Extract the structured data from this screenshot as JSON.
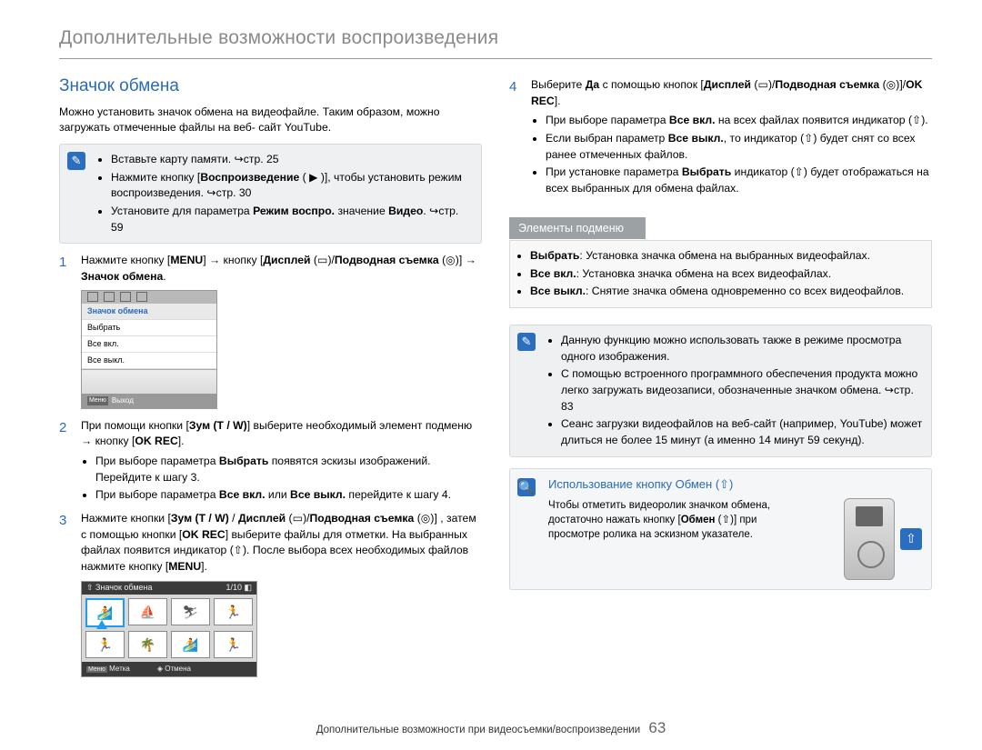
{
  "chapter": "Дополнительные возможности воспроизведения",
  "section": "Значок обмена",
  "intro_p1": "Можно установить значок обмена на видеофайле. Таким образом, можно загружать отмеченные файлы на веб- сайт YouTube.",
  "boxA": {
    "b1_a": "Вставьте карту памяти. ",
    "b1_b": "стр. 25",
    "b2_a": "Нажмите кнопку [",
    "b2_b": "Воспроизведение",
    "b2_c": " ( ▶ )], чтобы установить режим воспроизведения. ",
    "b2_d": "стр. 30",
    "b3_a": "Установите для параметра ",
    "b3_b": "Режим воспро.",
    "b3_c": " значение ",
    "b3_d": "Видео",
    "b3_e": ". ",
    "b3_f": "стр. 59"
  },
  "step1": {
    "num": "1",
    "a": "Нажмите кнопку [",
    "menu": "MENU",
    "b": "] → кнопку [",
    "disp": "Дисплей",
    "c": " (▭)/",
    "d": "Подводная съемка",
    "e": " (◎)] → ",
    "f": "Значок обмена",
    "g": "."
  },
  "ss1": {
    "title": "Значок обмена",
    "i1": "Выбрать",
    "i2": "Все вкл.",
    "i3": "Все выкл.",
    "menu_key": "Меню",
    "exit": "Выход"
  },
  "step2": {
    "num": "2",
    "a": "При помощи кнопки [",
    "b": "Зум (T / W)",
    "c": "] выберите необходимый элемент подменю → кнопку [",
    "d": "OK REC",
    "e": "].",
    "sb1_a": "При выборе параметра ",
    "sb1_b": "Выбрать",
    "sb1_c": " появятся эскизы изображений. Перейдите к шагу 3.",
    "sb2_a": "При выборе параметра ",
    "sb2_b": "Все вкл.",
    "sb2_c": " или ",
    "sb2_d": "Все выкл.",
    "sb2_e": " перейдите к шагу 4."
  },
  "step3": {
    "num": "3",
    "a": "Нажмите кнопки [",
    "b": "Зум (T / W)",
    "c": " / ",
    "d": "Дисплей",
    "e": " (▭)/",
    "f": "Подводная съемка",
    "g": " (◎)] , затем с помощью кнопки [",
    "h": "OK REC",
    "i": "] выберите файлы для отметки. На выбранных файлах появится индикатор (⇧). После выбора всех необходимых файлов нажмите кнопку [",
    "j": "MENU",
    "k": "]."
  },
  "ss2": {
    "title": "Значок обмена",
    "count": "1/10",
    "menu_key": "Меню",
    "mark": "Метка",
    "cancel_key": "◈",
    "cancel": "Отмена"
  },
  "step4": {
    "num": "4",
    "a": "Выберите ",
    "b": "Да",
    "c": " с помощью кнопок [",
    "d": "Дисплей",
    "e": " (▭)/",
    "f": "Подводная съемка",
    "g": " (◎)]/",
    "h": "OK REC",
    "i": "].",
    "sb1_a": "При выборе параметра ",
    "sb1_b": "Все вкл.",
    "sb1_c": " на всех файлах появится индикатор (⇧).",
    "sb2_a": "Если выбран параметр ",
    "sb2_b": "Все выкл.",
    "sb2_c": ", то индикатор (⇧) будет снят со всех ранее отмеченных файлов.",
    "sb3_a": "При установке параметра ",
    "sb3_b": "Выбрать",
    "sb3_c": " индикатор (⇧) будет отображаться на всех выбранных для обмена файлах."
  },
  "submenu": {
    "header": "Элементы подменю",
    "i1_a": "Выбрать",
    "i1_b": ": Установка значка обмена на выбранных видеофайлах.",
    "i2_a": "Все вкл.",
    "i2_b": ": Установка значка обмена на всех видеофайлах.",
    "i3_a": "Все выкл.",
    "i3_b": ": Снятие значка обмена одновременно со всех видеофайлов."
  },
  "boxB": {
    "b1": "Данную функцию можно использовать также в режиме просмотра одного изображения.",
    "b2_a": "С помощью встроенного программного обеспечения продукта можно легко загружать видеозаписи, обозначенные значком обмена. ",
    "b2_b": "стр. 83",
    "b3": "Сеанс загрузки видеофайлов на веб-сайт (например, YouTube) может длиться не более 15 минут (а именно 14 минут 59 секунд)."
  },
  "share": {
    "title": "Использование кнопку Обмен (⇧)",
    "body_a": "Чтобы отметить видеоролик значком обмена, достаточно нажать кнопку [",
    "body_b": "Обмен",
    "body_c": " (⇧)] при просмотре ролика на эскизном указателе."
  },
  "footer": {
    "label": "Дополнительные возможности при видеосъемки/воспроизведении",
    "page": "63"
  }
}
